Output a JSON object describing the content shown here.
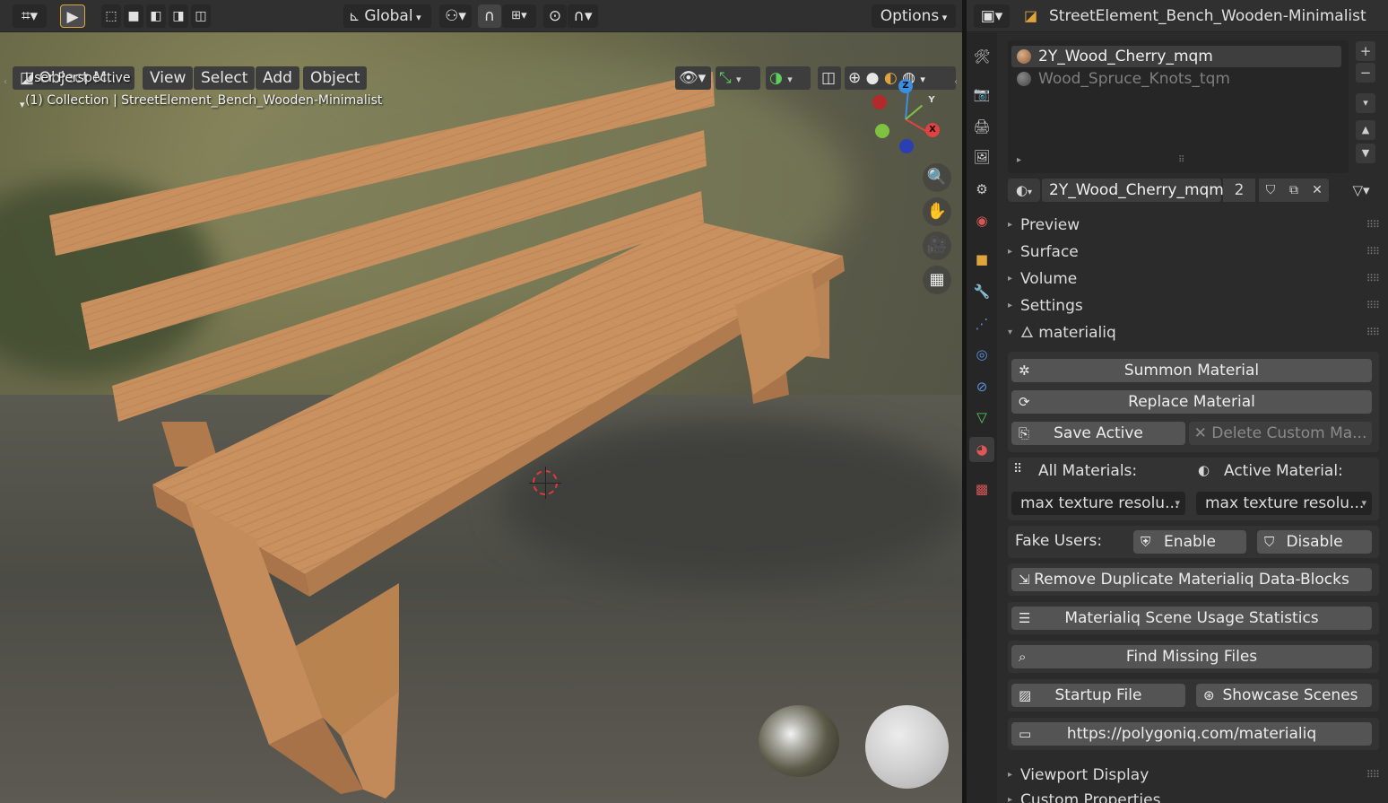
{
  "viewport": {
    "header": {
      "transform_orientation": "Global",
      "options_label": "Options"
    },
    "menu": {
      "mode_label": "Object M...",
      "items": [
        "View",
        "Select",
        "Add",
        "Object"
      ]
    },
    "overlay": {
      "perspective": "User Perspective",
      "collection_info": "(1) Collection | StreetElement_Bench_Wooden-Minimalist"
    },
    "gizmo": {
      "z": "Z",
      "y": "Y",
      "x": "X"
    }
  },
  "properties": {
    "object_name": "StreetElement_Bench_Wooden-Minimalist",
    "material_slots": [
      {
        "name": "2Y_Wood_Cherry_mqm",
        "selected": true
      },
      {
        "name": "Wood_Spruce_Knots_tqm",
        "selected": false
      }
    ],
    "active_material": {
      "name": "2Y_Wood_Cherry_mqm",
      "users": "2"
    },
    "sections": {
      "preview": "Preview",
      "surface": "Surface",
      "volume": "Volume",
      "settings": "Settings",
      "materialiq": "materialiq",
      "viewport_display": "Viewport Display",
      "custom_properties": "Custom Properties"
    },
    "materialiq": {
      "summon": "Summon Material",
      "replace": "Replace Material",
      "save_active": "Save Active",
      "delete_custom": "Delete Custom Ma...",
      "all_materials_label": "All Materials:",
      "active_material_label": "Active Material:",
      "all_resolution": "max texture resolu...",
      "active_resolution": "max texture resolu...",
      "fake_users_label": "Fake Users:",
      "enable": "Enable",
      "disable": "Disable",
      "remove_duplicates": "Remove Duplicate Materialiq Data-Blocks",
      "usage_stats": "Materialiq Scene Usage Statistics",
      "find_missing": "Find Missing Files",
      "startup_file": "Startup File",
      "showcase_scenes": "Showcase Scenes",
      "website": "https://polygoniq.com/materialiq"
    }
  },
  "colors": {
    "accent": "#e0a43c",
    "wood": "#c8905e",
    "button": "#545454",
    "panel": "#2b2b2b"
  }
}
